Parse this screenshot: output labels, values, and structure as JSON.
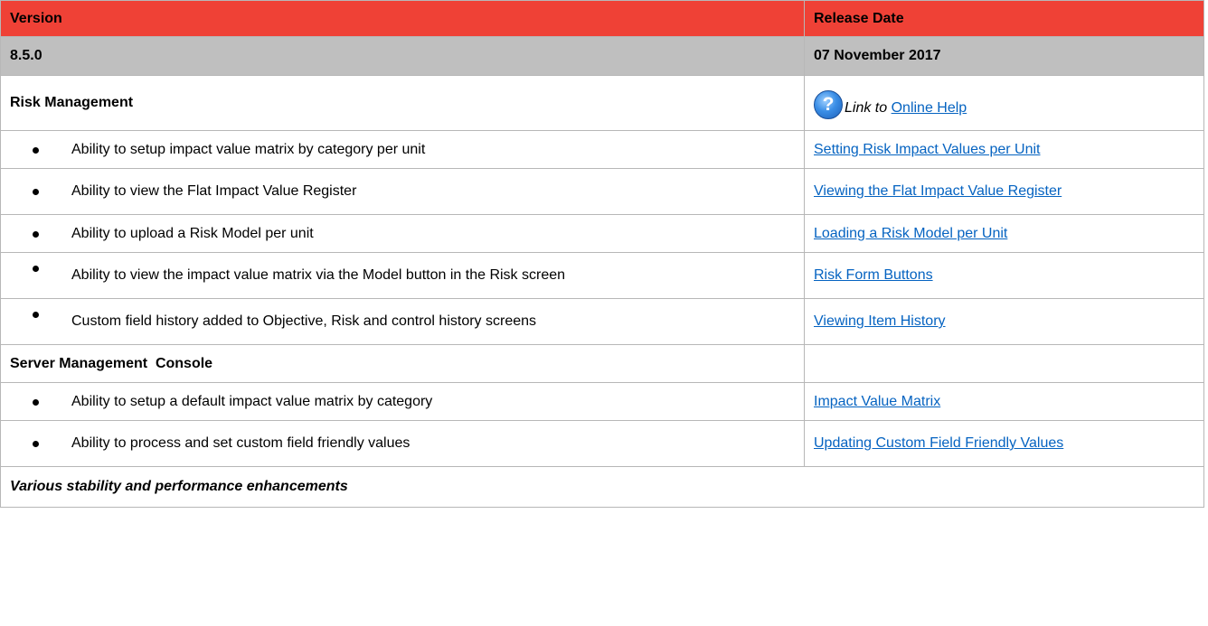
{
  "header": {
    "version_label": "Version",
    "release_date_label": "Release Date"
  },
  "release": {
    "version": "8.5.0",
    "date": "07 November 2017"
  },
  "sections": {
    "risk": {
      "title": "Risk Management",
      "help_prefix": "Link to",
      "help_link": "Online Help",
      "help_icon": "help-question-icon",
      "items": [
        {
          "feature": "Ability to setup impact value matrix by category per unit",
          "link": "Setting Risk Impact Values per Unit"
        },
        {
          "feature": "Ability to view the Flat Impact Value Register",
          "link": "Viewing the Flat Impact Value Register"
        },
        {
          "feature": "Ability to upload a Risk Model per unit",
          "link": "Loading a Risk Model per Unit"
        },
        {
          "feature": "Ability to view the impact value matrix via the Model button in the Risk screen",
          "link": "Risk Form Buttons"
        },
        {
          "feature": "Custom field history added to Objective, Risk and control history screens",
          "link": "Viewing Item History"
        }
      ]
    },
    "server": {
      "title": "Server Management  Console",
      "items": [
        {
          "feature": "Ability to setup a default impact value matrix by category",
          "link": "Impact Value Matrix"
        },
        {
          "feature": "Ability to process and set custom field friendly values",
          "link": "Updating Custom Field Friendly Values"
        }
      ]
    }
  },
  "footer": {
    "note": "Various stability and performance enhancements"
  },
  "colors": {
    "header_bg": "#ef4136",
    "version_bg": "#bfbfbf",
    "link": "#0563c1"
  }
}
